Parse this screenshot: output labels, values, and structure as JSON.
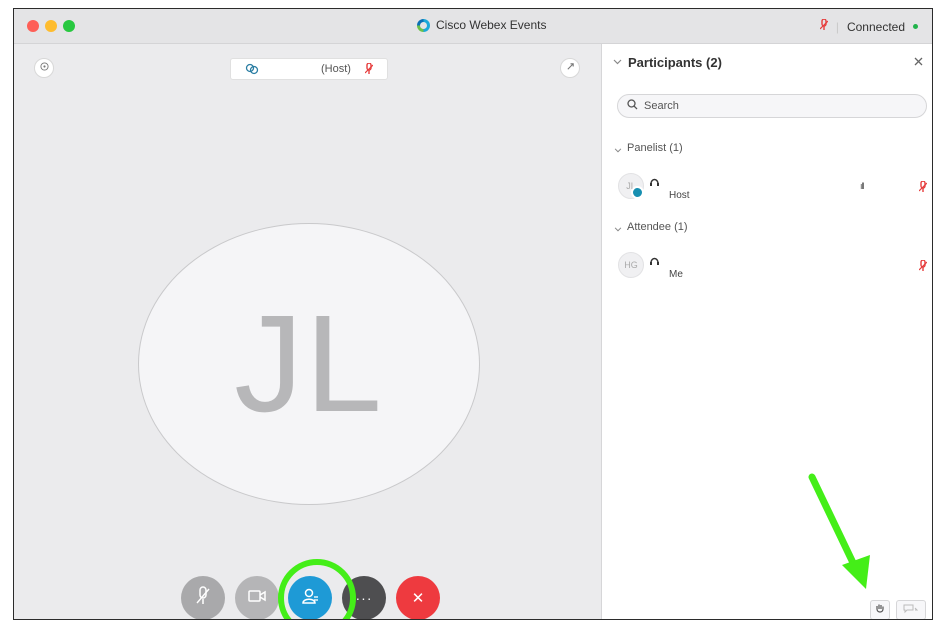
{
  "window": {
    "title": "Cisco Webex Events",
    "status_text": "Connected",
    "status_color": "#21b34b"
  },
  "stage": {
    "host_label": "(Host)",
    "avatar_initials": "JL",
    "icons": {
      "info": "info-icon",
      "popout": "pin-icon",
      "host_mic": "mic-muted-icon"
    }
  },
  "controls": {
    "mute": {
      "icon": "mic-muted-icon",
      "color": "#a9a9ab"
    },
    "video": {
      "icon": "video-icon",
      "color": "#b5b5b7"
    },
    "participants": {
      "icon": "participants-icon",
      "color": "#1e9ad6"
    },
    "more": {
      "label": "···",
      "color": "#4e4e50"
    },
    "leave": {
      "label": "✕",
      "color": "#ee3a3f"
    },
    "highlight_color": "#44ee18"
  },
  "participants_panel": {
    "title": "Participants (2)",
    "search_placeholder": "Search",
    "sections": [
      {
        "label": "Panelist (1)",
        "people": [
          {
            "role": "Host",
            "avatar_initials": "JL",
            "has_badge": true,
            "signal": "ıll"
          }
        ]
      },
      {
        "label": "Attendee (1)",
        "people": [
          {
            "role": "Me",
            "avatar_initials": "HG",
            "has_badge": false
          }
        ]
      }
    ],
    "bottom_buttons": {
      "raise_hand": "raise-hand-icon",
      "reactions": "chat-icon"
    }
  },
  "annotation": {
    "arrow_color": "#44ee18"
  }
}
